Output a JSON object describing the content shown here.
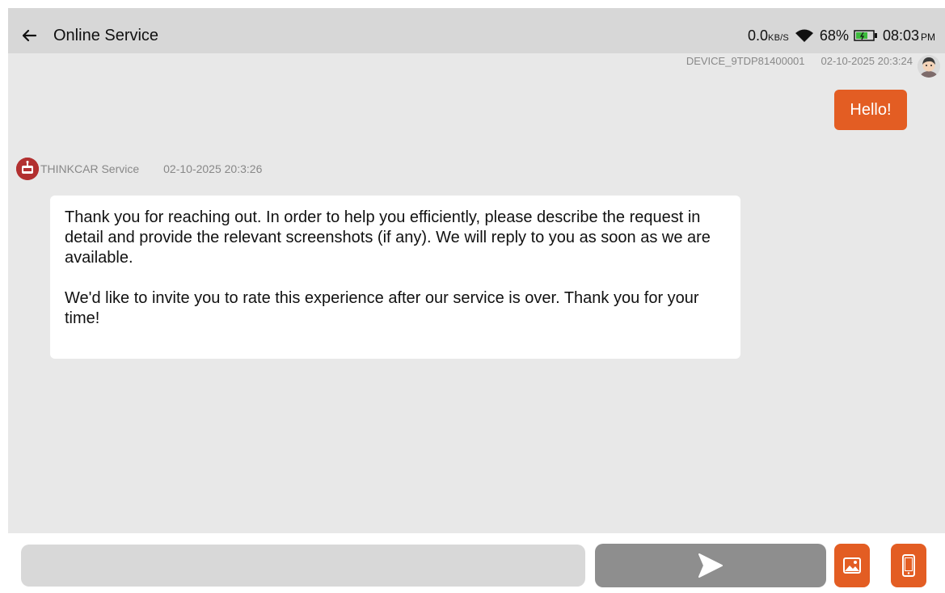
{
  "header": {
    "title": "Online Service",
    "back_icon": "back-arrow-icon"
  },
  "status_bar": {
    "network_speed": "0.0",
    "network_unit": "KB/S",
    "battery_percent": "68%",
    "time": "08:03",
    "period": "PM"
  },
  "chat": {
    "outgoing": {
      "sender": "DEVICE_9TDP81400001",
      "timestamp": "02-10-2025 20:3:24",
      "message": "Hello!"
    },
    "incoming": {
      "sender": "THINKCAR Service",
      "timestamp": "02-10-2025 20:3:26",
      "paragraph_1": "Thank you for reaching out. In order to help you efficiently, please describe the request in detail and provide the relevant screenshots (if any). We will reply to you as soon as we are available.",
      "paragraph_2": "We'd like to invite you to rate this experience after our service is over. Thank you for your time!"
    }
  },
  "composer": {
    "input_value": "",
    "input_placeholder": ""
  },
  "colors": {
    "accent": "#e35d23",
    "topbar": "#d7d7d7",
    "chat_background": "#e8e8e8",
    "send_button": "#8e8e8e",
    "service_icon": "#b23030"
  }
}
